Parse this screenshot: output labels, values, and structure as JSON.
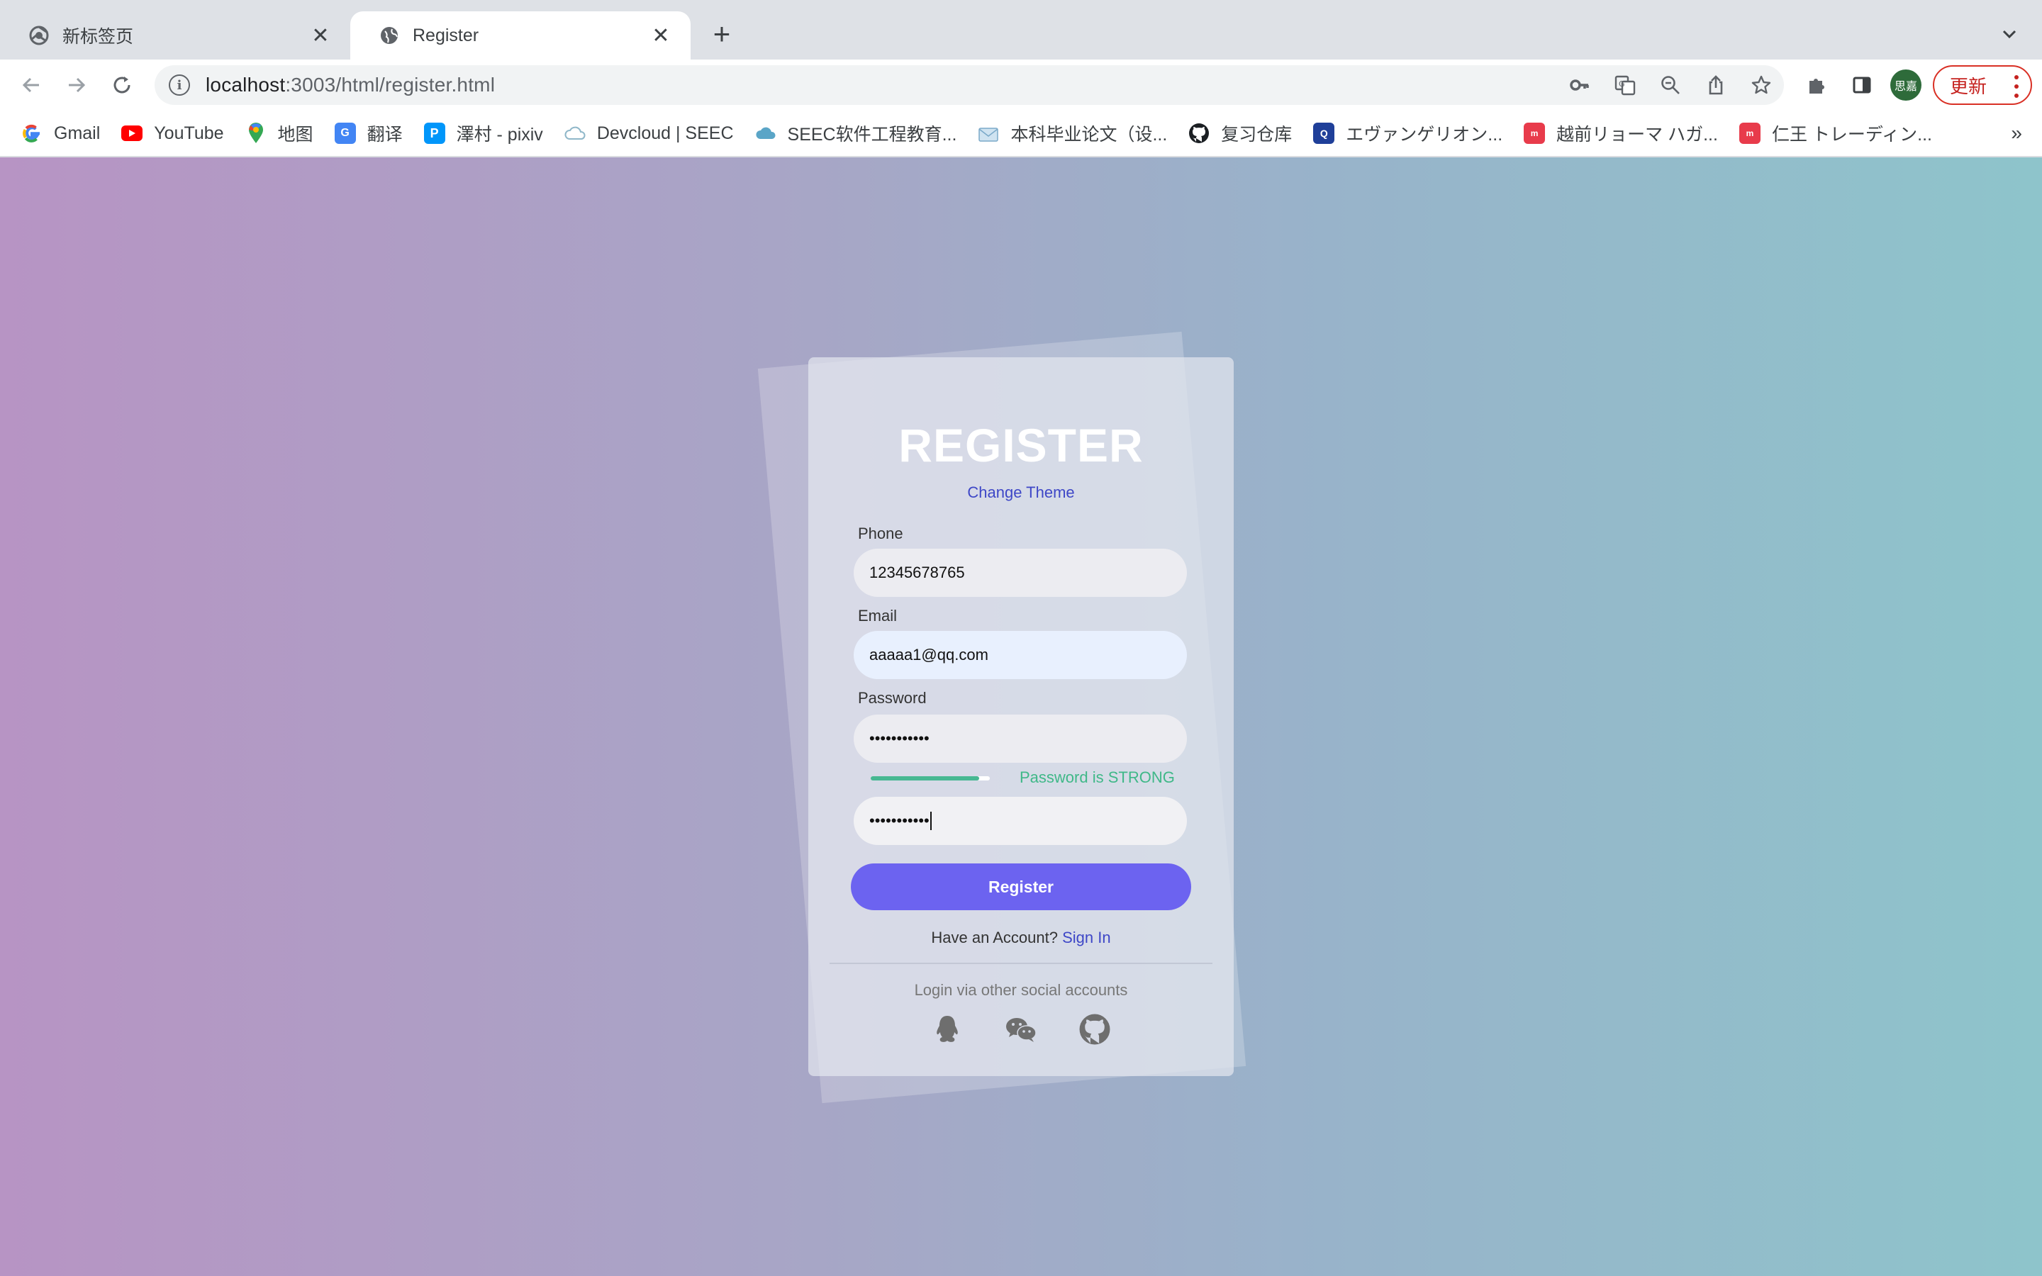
{
  "browser": {
    "tabs": [
      {
        "title": "新标签页",
        "active": false
      },
      {
        "title": "Register",
        "active": true
      }
    ],
    "url_host": "localhost",
    "url_path": ":3003/html/register.html",
    "profile_initials": "思嘉",
    "update_label": "更新",
    "bookmarks": [
      {
        "label": "Gmail",
        "icon": "google-icon"
      },
      {
        "label": "YouTube",
        "icon": "youtube-icon"
      },
      {
        "label": "地图",
        "icon": "maps-pin-icon"
      },
      {
        "label": "翻译",
        "icon": "translate-icon"
      },
      {
        "label": "澤村 - pixiv",
        "icon": "pixiv-icon"
      },
      {
        "label": "Devcloud | SEEC",
        "icon": "cloud-icon"
      },
      {
        "label": "SEEC软件工程教育...",
        "icon": "cloud-icon"
      },
      {
        "label": "本科毕业论文（设...",
        "icon": "mail-icon"
      },
      {
        "label": "复习仓库",
        "icon": "github-icon"
      },
      {
        "label": "エヴァンゲリオン...",
        "icon": "site-icon"
      },
      {
        "label": "越前リョーマ ハガ...",
        "icon": "mercari-icon"
      },
      {
        "label": "仁王 トレーディン...",
        "icon": "mercari-icon"
      }
    ],
    "more_bookmarks": "»"
  },
  "form": {
    "title": "REGISTER",
    "change_theme": "Change Theme",
    "phone_label": "Phone",
    "phone_value": "12345678765",
    "email_label": "Email",
    "email_value": "aaaaa1@qq.com",
    "password_label": "Password",
    "password_value": "•••••••••••",
    "confirm_value": "•••••••••••",
    "strength_text": "Password is STRONG",
    "strength_level": 0.91,
    "register_label": "Register",
    "have_account": "Have an Account?",
    "sign_in": "Sign In",
    "social_text": "Login via other social accounts",
    "social": [
      "qq-icon",
      "wechat-icon",
      "github-icon"
    ]
  },
  "colors": {
    "accent": "#6c63f0",
    "link": "#3e47c7",
    "strong": "#47b892",
    "update": "#d93025"
  }
}
